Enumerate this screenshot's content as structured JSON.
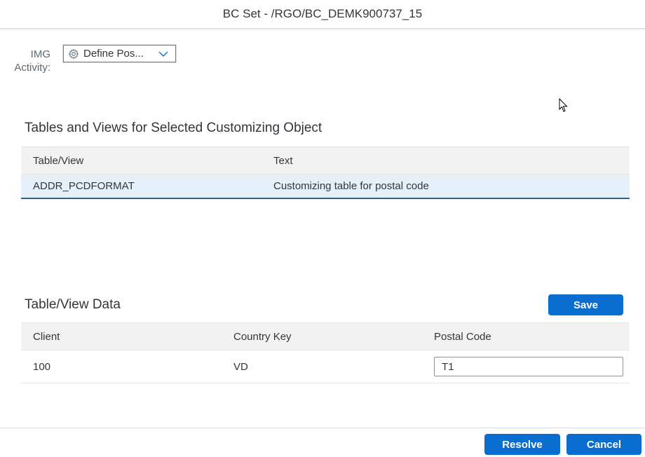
{
  "dialog": {
    "title": "BC Set - /RGO/BC_DEMK900737_15"
  },
  "img_activity": {
    "label_line1": "IMG",
    "label_line2": "Activity:",
    "selected": "Define Pos...",
    "icon": "gear-icon"
  },
  "tables_section": {
    "title": "Tables and Views for Selected Customizing Object",
    "columns": [
      "Table/View",
      "Text"
    ],
    "rows": [
      {
        "table_view": "ADDR_PCDFORMAT",
        "text": "Customizing table for postal code"
      }
    ]
  },
  "data_section": {
    "title": "Table/View Data",
    "save_label": "Save",
    "columns": [
      "Client",
      "Country Key",
      "Postal Code"
    ],
    "rows": [
      {
        "client": "100",
        "country_key": "VD",
        "postal_code": "T1"
      }
    ]
  },
  "footer": {
    "resolve_label": "Resolve",
    "cancel_label": "Cancel"
  },
  "colors": {
    "accent": "#0a6ed1",
    "selected_row": "#e5f0fa",
    "header_row": "#f2f2f2"
  }
}
